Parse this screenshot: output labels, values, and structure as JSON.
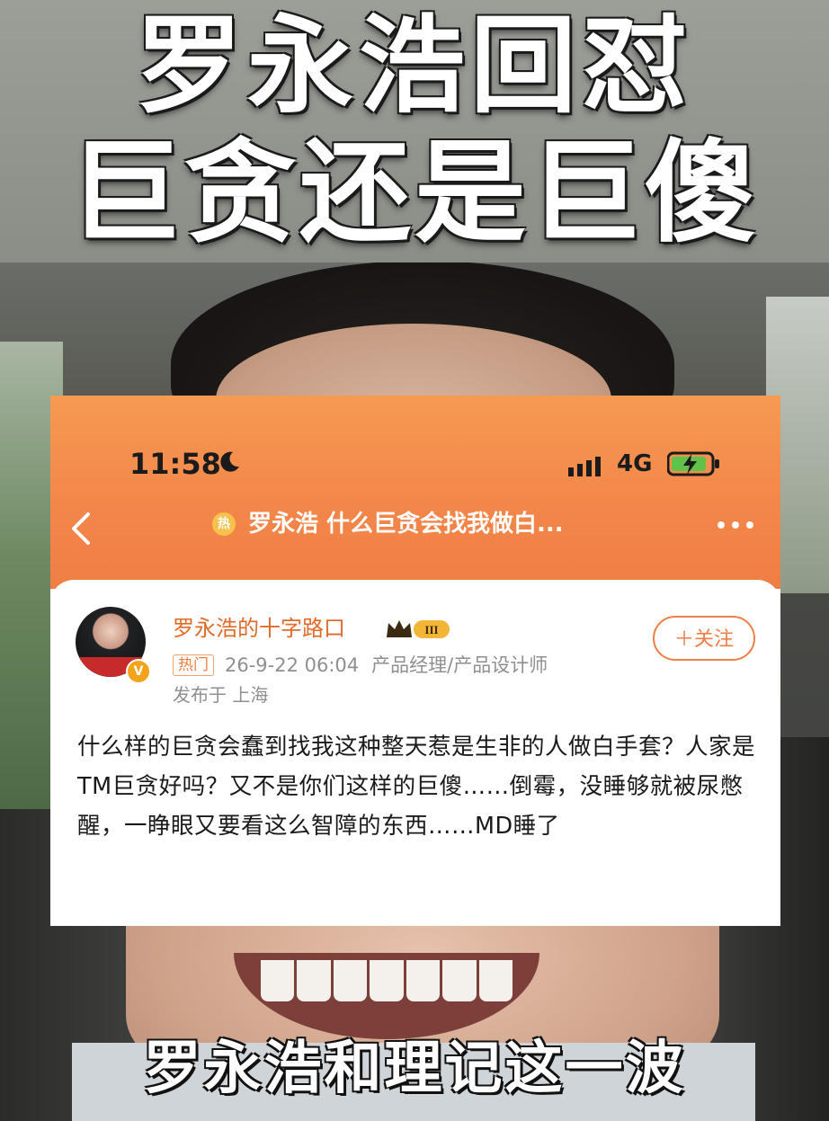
{
  "overlay": {
    "title_line1": "罗永浩回怼",
    "title_line2": "巨贪还是巨傻",
    "caption": "罗永浩和理记这一波",
    "watermark": "..."
  },
  "phone": {
    "status_bar": {
      "time": "11:58",
      "network": "4G",
      "icons": [
        "moon-icon",
        "signal-icon",
        "battery-charging-icon"
      ]
    },
    "nav": {
      "hot_badge": "热",
      "title": "罗永浩 什么巨贪会找我做白...",
      "icons": [
        "back-chevron-icon",
        "more-dots-icon"
      ]
    },
    "post": {
      "author": "罗永浩的十字路口",
      "level_badge": "III",
      "follow_label": "＋关注",
      "tag": "热门",
      "datetime": "26-9-22 06:04",
      "profession": "产品经理/产品设计师",
      "location": "发布于 上海",
      "verified": "V",
      "text": "什么样的巨贪会蠢到找我这种整天惹是生非的人做白手套？人家是TM巨贪好吗？又不是你们这样的巨傻……倒霉，没睡够就被尿憋醒，一睁眼又要看这么智障的东西……MD睡了"
    }
  },
  "colors": {
    "header_orange": "#f3874a",
    "accent_orange": "#f07e45",
    "username_color": "#e06a2a",
    "meta_gray": "#8f8f8f"
  }
}
